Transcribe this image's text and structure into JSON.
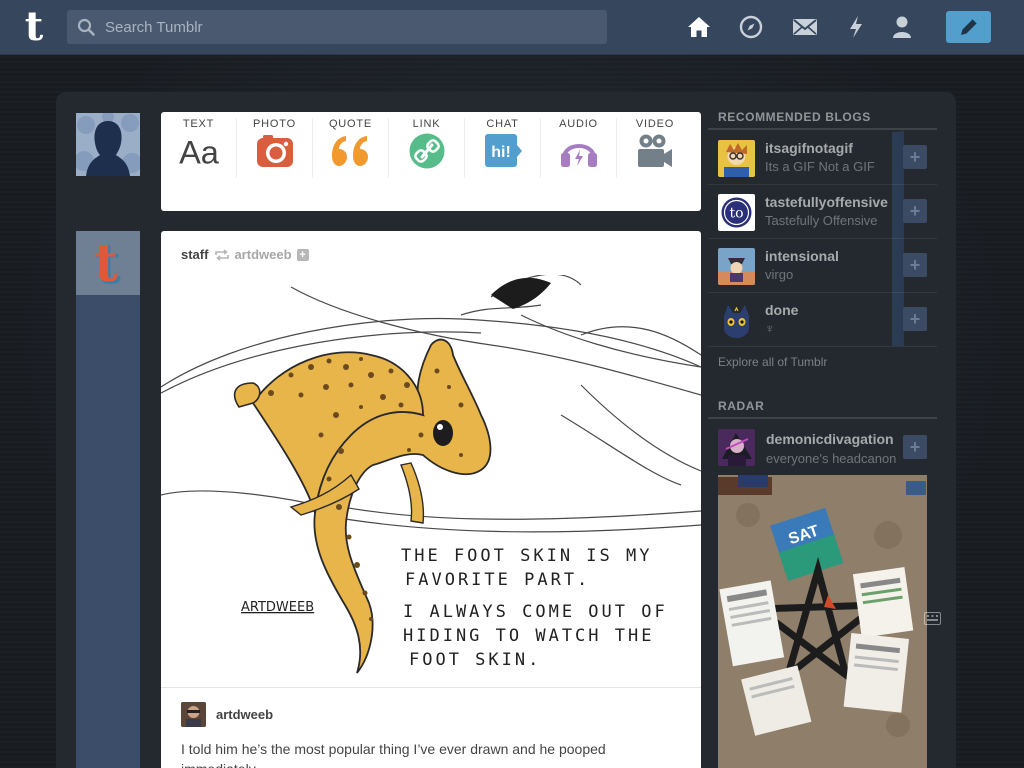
{
  "header": {
    "logo_letter": "t",
    "search_placeholder": "Search Tumblr",
    "nav": [
      "home-icon",
      "explore-compass-icon",
      "inbox-mail-icon",
      "activity-lightning-icon",
      "account-person-icon"
    ],
    "compose_icon": "pencil-icon",
    "accent": "#529ecc",
    "bar_color": "#36465d"
  },
  "post_types": [
    {
      "label": "TEXT",
      "icon": "text-aa-icon",
      "color": "#444444"
    },
    {
      "label": "PHOTO",
      "icon": "camera-icon",
      "color": "#d95e40"
    },
    {
      "label": "QUOTE",
      "icon": "quote-icon",
      "color": "#f2992e"
    },
    {
      "label": "LINK",
      "icon": "link-icon",
      "color": "#56bc8a"
    },
    {
      "label": "CHAT",
      "icon": "chat-bubble-icon",
      "color": "#529ecc"
    },
    {
      "label": "AUDIO",
      "icon": "headphones-icon",
      "color": "#a77dc2"
    },
    {
      "label": "VIDEO",
      "icon": "video-camera-icon",
      "color": "#748089"
    }
  ],
  "post": {
    "author": "staff",
    "reblogged_from": "artdweeb",
    "follow_glyph": "+",
    "art_caption_lines": [
      "THE FOOT SKIN IS MY",
      "FAVORITE PART.",
      "I ALWAYS COME OUT OF",
      "HIDING TO WATCH THE",
      "FOOT SKIN."
    ],
    "art_signature": "ARTDWEEB",
    "source_name": "artdweeb",
    "body": "I told him he’s the most popular thing I’ve ever drawn and he pooped immediately."
  },
  "sidebar": {
    "recommended_heading": "RECOMMENDED BLOGS",
    "recommended": [
      {
        "name": "itsagifnotagif",
        "desc": "Its a GIF Not a GIF",
        "avatar_color": "#e7c341"
      },
      {
        "name": "tastefullyoffensive",
        "desc": "Tastefully Offensive",
        "avatar_color": "#2b2f77",
        "avatar_text": "to"
      },
      {
        "name": "intensional",
        "desc": "virgo",
        "avatar_color": "#6a8fb0"
      },
      {
        "name": "done",
        "desc": "♆",
        "avatar_color": "#243a6b"
      }
    ],
    "follow_glyph": "+",
    "explore_link": "Explore all of Tumblr",
    "radar_heading": "RADAR",
    "radar": {
      "name": "demonicdivagation",
      "desc": "everyone's headcanon",
      "avatar_color": "#4a2a5c"
    },
    "radar_image_card": "SAT"
  }
}
